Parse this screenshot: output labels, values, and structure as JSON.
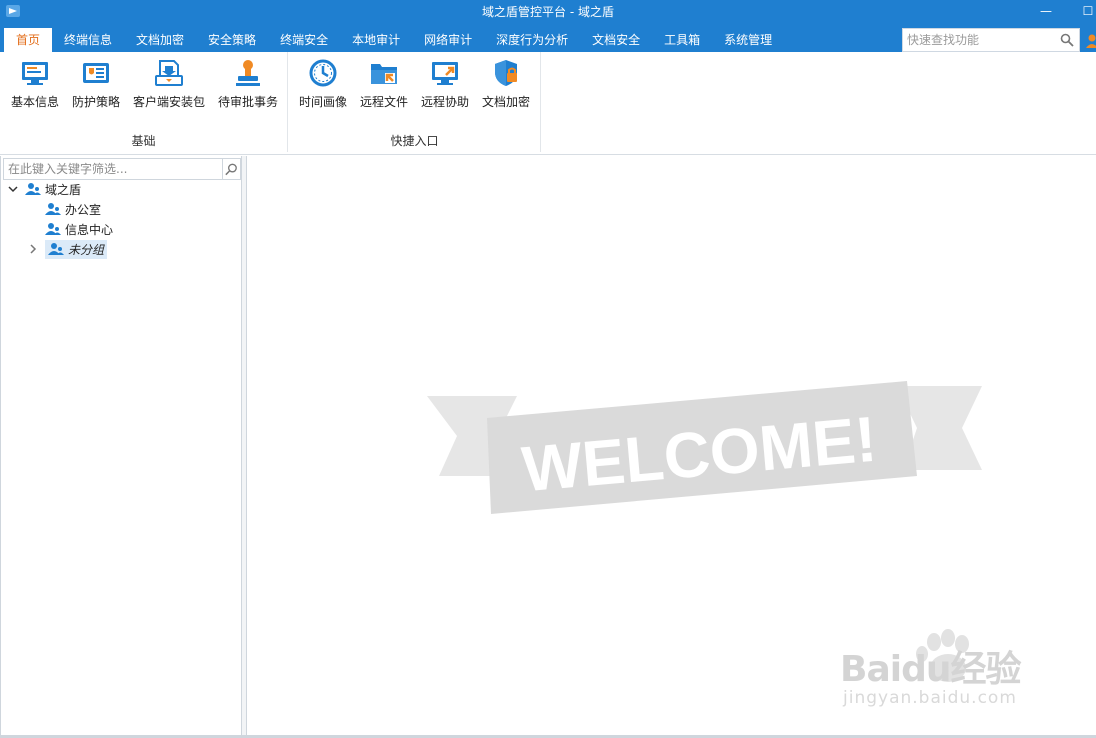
{
  "window": {
    "title": "域之盾管控平台 - 域之盾",
    "minimize_glyph": "—",
    "maximize_glyph": "☐"
  },
  "menu": {
    "items": [
      "首页",
      "终端信息",
      "文档加密",
      "安全策略",
      "终端安全",
      "本地审计",
      "网络审计",
      "深度行为分析",
      "文档安全",
      "工具箱",
      "系统管理"
    ],
    "active_index": 0,
    "active_color": "#e36e1b",
    "bar_color": "#1f7fd0"
  },
  "quick_search": {
    "placeholder": "快速查找功能",
    "icon": "search-icon"
  },
  "ribbon": {
    "groups": [
      {
        "label": "基础",
        "buttons": [
          {
            "label": "基本信息",
            "icon": "computer-info-icon"
          },
          {
            "label": "防护策略",
            "icon": "policy-card-icon"
          },
          {
            "label": "客户端安装包",
            "icon": "install-package-icon"
          },
          {
            "label": "待审批事务",
            "icon": "approval-stamp-icon"
          }
        ]
      },
      {
        "label": "快捷入口",
        "buttons": [
          {
            "label": "时间画像",
            "icon": "clock-icon"
          },
          {
            "label": "远程文件",
            "icon": "remote-folder-icon"
          },
          {
            "label": "远程协助",
            "icon": "remote-desktop-icon"
          },
          {
            "label": "文档加密",
            "icon": "shield-lock-icon"
          }
        ]
      }
    ]
  },
  "left_panel": {
    "filter_placeholder": "在此键入关键字筛选...",
    "tree": {
      "root": "域之盾",
      "children": [
        "办公室",
        "信息中心",
        "未分组"
      ]
    }
  },
  "content": {
    "welcome_text": "WELCOME!"
  },
  "watermark": {
    "brand": "Baidu经验",
    "url": "jingyan.baidu.com"
  }
}
